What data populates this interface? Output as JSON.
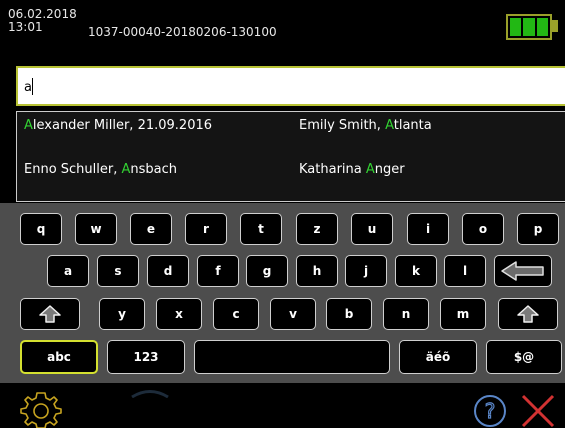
{
  "header": {
    "date": "06.02.2018",
    "time": "13:01",
    "record_id": "1037-00040-20180206-130100",
    "battery_level": 1.0,
    "battery_color": "#22b814"
  },
  "search": {
    "value": "a",
    "placeholder": ""
  },
  "suggestions": [
    {
      "pre": "",
      "hl": "A",
      "post": "lexander Miller, 21.09.2016"
    },
    {
      "pre": "Emily Smith, ",
      "hl": "A",
      "post": "tlanta"
    },
    {
      "pre": "Enno Schuller, ",
      "hl": "A",
      "post": "nsbach"
    },
    {
      "pre": "Katharina ",
      "hl": "A",
      "post": "nger"
    }
  ],
  "keyboard": {
    "row1": [
      "q",
      "w",
      "e",
      "r",
      "t",
      "z",
      "u",
      "i",
      "o",
      "p"
    ],
    "row2": [
      "a",
      "s",
      "d",
      "f",
      "g",
      "h",
      "j",
      "k",
      "l"
    ],
    "row3": [
      "y",
      "x",
      "c",
      "v",
      "b",
      "n",
      "m"
    ],
    "abc": "abc",
    "num": "123",
    "umlaut": "äéõ",
    "symbols": "$@"
  },
  "footer": {
    "settings_icon": "gear-icon",
    "help_icon": "help-icon",
    "close_icon": "close-icon"
  },
  "colors": {
    "accent": "#d4e030",
    "highlight": "#32d232",
    "close": "#d23232",
    "help": "#5a86c8",
    "gear": "#c7a420"
  }
}
